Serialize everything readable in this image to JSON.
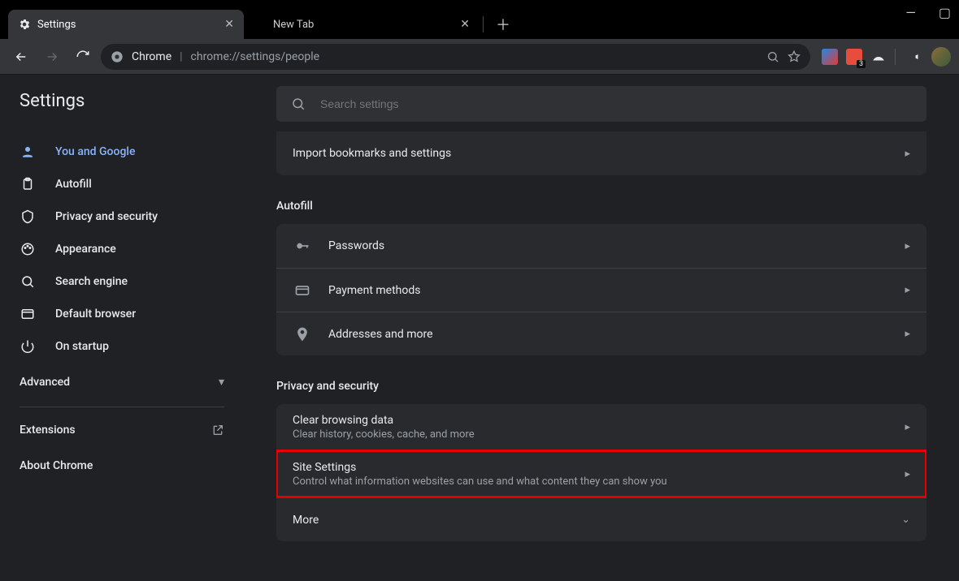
{
  "window": {
    "tabs": [
      {
        "label": "Settings",
        "active": true
      },
      {
        "label": "New Tab",
        "active": false
      }
    ]
  },
  "omnibox": {
    "scheme_label": "Chrome",
    "url": "chrome://settings/people"
  },
  "extensions": {
    "badge": "3"
  },
  "sidebar": {
    "title": "Settings",
    "items": [
      {
        "label": "You and Google",
        "icon": "person",
        "active": true
      },
      {
        "label": "Autofill",
        "icon": "clipboard",
        "active": false
      },
      {
        "label": "Privacy and security",
        "icon": "shield",
        "active": false
      },
      {
        "label": "Appearance",
        "icon": "palette",
        "active": false
      },
      {
        "label": "Search engine",
        "icon": "search",
        "active": false
      },
      {
        "label": "Default browser",
        "icon": "browser",
        "active": false
      },
      {
        "label": "On startup",
        "icon": "power",
        "active": false
      }
    ],
    "advanced": "Advanced",
    "extensions": "Extensions",
    "about": "About Chrome"
  },
  "search": {
    "placeholder": "Search settings"
  },
  "main": {
    "top_row": {
      "label": "Import bookmarks and settings"
    },
    "sections": [
      {
        "title": "Autofill",
        "rows": [
          {
            "icon": "key",
            "label": "Passwords"
          },
          {
            "icon": "card",
            "label": "Payment methods"
          },
          {
            "icon": "pin",
            "label": "Addresses and more"
          }
        ]
      },
      {
        "title": "Privacy and security",
        "rows": [
          {
            "label": "Clear browsing data",
            "sub": "Clear history, cookies, cache, and more"
          },
          {
            "label": "Site Settings",
            "sub": "Control what information websites can use and what content they can show you",
            "highlight": true
          },
          {
            "label": "More",
            "expand": true
          }
        ]
      }
    ]
  }
}
